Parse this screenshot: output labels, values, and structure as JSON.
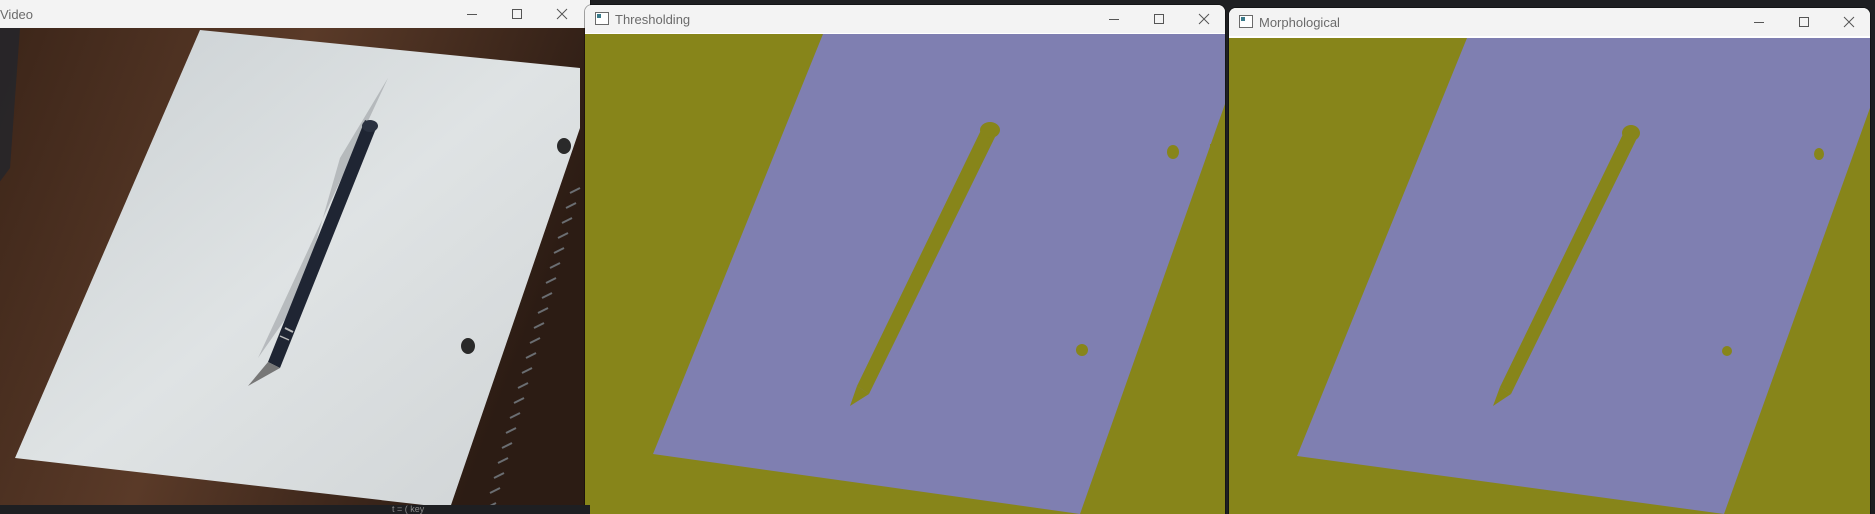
{
  "windows": {
    "video": {
      "title": "Video"
    },
    "thresholding": {
      "title": "Thresholding"
    },
    "morphological": {
      "title": "Morphological"
    }
  },
  "controls": {
    "minimize": "minimize-icon",
    "maximize": "maximize-icon",
    "close": "close-icon"
  },
  "colors": {
    "threshold_background": "#87851a",
    "threshold_foreground": "#7f7fb1",
    "titlebar": "#f3f3f3",
    "title_text": "#6b6b6b"
  },
  "background_code": {
    "snippet": "t = ( key"
  }
}
